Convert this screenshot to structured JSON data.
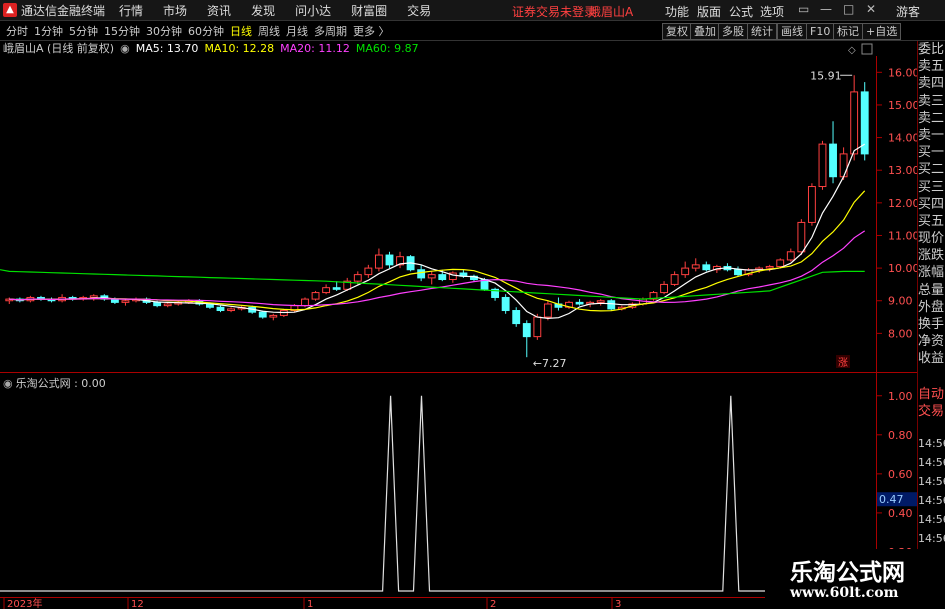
{
  "menubar": {
    "app_title": "通达信金融终端",
    "items": [
      "行情",
      "市场",
      "资讯",
      "发现",
      "问小达",
      "财富圈",
      "交易"
    ],
    "warning": "证券交易未登录",
    "stock": "峨眉山A",
    "right_items": [
      "功能",
      "版面",
      "公式",
      "选项"
    ],
    "guest": "游客"
  },
  "periods": [
    "分时",
    "1分钟",
    "5分钟",
    "15分钟",
    "30分钟",
    "60分钟",
    "日线",
    "周线",
    "月线",
    "多周期",
    "更多 〉"
  ],
  "active_period": "日线",
  "toolbar": [
    "复权",
    "叠加",
    "多股",
    "统计",
    "画线",
    "F10",
    "标记",
    "+自选"
  ],
  "legend": {
    "title": "峨眉山A (日线 前复权)",
    "ma5": "MA5: 13.70",
    "ma10": "MA10: 12.28",
    "ma20": "MA20: 11.12",
    "ma60": "MA60: 9.87",
    "colors": {
      "ma5": "#ffffff",
      "ma10": "#ffff00",
      "ma20": "#ff40ff",
      "ma60": "#00e000"
    }
  },
  "main_axis": [
    "16.00",
    "15.00",
    "14.00",
    "13.00",
    "12.00",
    "11.00",
    "10.00",
    "9.00",
    "8.00"
  ],
  "annotations": {
    "high": "15.91",
    "low": "7.27",
    "zhang": "涨"
  },
  "indicator": {
    "name": "乐淘公式网 : 0.00",
    "axis": [
      "1.00",
      "0.80",
      "0.60",
      "0.47",
      "0.40",
      "0.20"
    ],
    "highlight": "0.47"
  },
  "x_axis": [
    "2023年",
    "12",
    "1",
    "2",
    "3"
  ],
  "right_panel": {
    "items": [
      "委比",
      "卖五",
      "卖四",
      "卖三",
      "卖二",
      "卖一",
      "买一",
      "买二",
      "买三",
      "买四",
      "买五",
      "现价",
      "涨跌",
      "涨幅",
      "总量",
      "外盘",
      "换手",
      "净资",
      "收益"
    ],
    "lower": [
      "自动",
      "交易"
    ],
    "times": [
      "14:56",
      "14:56",
      "14:56",
      "14:56",
      "14:56",
      "14:56",
      "14:56"
    ]
  },
  "watermark": {
    "name": "乐淘公式网",
    "url": "www.60lt.com"
  },
  "chart_data": {
    "type": "candlestick",
    "price_ylim": [
      7.0,
      16.5
    ],
    "candles": [
      [
        9.0,
        9.1,
        8.9,
        9.05
      ],
      [
        9.05,
        9.1,
        8.95,
        9.0
      ],
      [
        9.0,
        9.15,
        8.95,
        9.1
      ],
      [
        9.1,
        9.15,
        9.0,
        9.05
      ],
      [
        9.05,
        9.1,
        8.95,
        9.0
      ],
      [
        9.0,
        9.2,
        8.95,
        9.1
      ],
      [
        9.1,
        9.15,
        9.0,
        9.05
      ],
      [
        9.05,
        9.15,
        9.0,
        9.1
      ],
      [
        9.1,
        9.2,
        9.0,
        9.15
      ],
      [
        9.15,
        9.2,
        9.0,
        9.05
      ],
      [
        9.05,
        9.1,
        8.9,
        8.95
      ],
      [
        8.95,
        9.05,
        8.85,
        9.0
      ],
      [
        9.0,
        9.1,
        8.95,
        9.05
      ],
      [
        9.05,
        9.1,
        8.9,
        8.95
      ],
      [
        8.95,
        9.0,
        8.8,
        8.85
      ],
      [
        8.85,
        8.95,
        8.8,
        8.9
      ],
      [
        8.9,
        9.0,
        8.85,
        8.95
      ],
      [
        8.95,
        9.05,
        8.9,
        9.0
      ],
      [
        9.0,
        9.05,
        8.85,
        8.9
      ],
      [
        8.9,
        8.95,
        8.75,
        8.8
      ],
      [
        8.8,
        8.85,
        8.65,
        8.7
      ],
      [
        8.7,
        8.8,
        8.65,
        8.75
      ],
      [
        8.75,
        8.85,
        8.7,
        8.8
      ],
      [
        8.8,
        8.85,
        8.6,
        8.65
      ],
      [
        8.65,
        8.7,
        8.45,
        8.5
      ],
      [
        8.5,
        8.6,
        8.4,
        8.55
      ],
      [
        8.55,
        8.75,
        8.5,
        8.7
      ],
      [
        8.7,
        8.9,
        8.65,
        8.85
      ],
      [
        8.85,
        9.1,
        8.8,
        9.05
      ],
      [
        9.05,
        9.3,
        9.0,
        9.25
      ],
      [
        9.25,
        9.5,
        9.2,
        9.4
      ],
      [
        9.4,
        9.6,
        9.3,
        9.35
      ],
      [
        9.35,
        9.7,
        9.3,
        9.6
      ],
      [
        9.6,
        9.9,
        9.5,
        9.8
      ],
      [
        9.8,
        10.1,
        9.7,
        10.0
      ],
      [
        10.0,
        10.6,
        9.9,
        10.4
      ],
      [
        10.4,
        10.5,
        10.0,
        10.1
      ],
      [
        10.1,
        10.5,
        10.0,
        10.35
      ],
      [
        10.35,
        10.4,
        9.9,
        9.95
      ],
      [
        9.95,
        10.1,
        9.6,
        9.7
      ],
      [
        9.7,
        9.9,
        9.5,
        9.8
      ],
      [
        9.8,
        9.95,
        9.6,
        9.65
      ],
      [
        9.65,
        9.9,
        9.55,
        9.85
      ],
      [
        9.85,
        9.95,
        9.7,
        9.75
      ],
      [
        9.75,
        9.8,
        9.6,
        9.65
      ],
      [
        9.65,
        9.7,
        9.3,
        9.35
      ],
      [
        9.35,
        9.4,
        9.0,
        9.1
      ],
      [
        9.1,
        9.2,
        8.6,
        8.7
      ],
      [
        8.7,
        8.8,
        8.2,
        8.3
      ],
      [
        8.3,
        8.4,
        7.27,
        7.9
      ],
      [
        7.9,
        8.6,
        7.8,
        8.5
      ],
      [
        8.5,
        9.0,
        8.4,
        8.9
      ],
      [
        8.9,
        9.1,
        8.7,
        8.8
      ],
      [
        8.8,
        9.0,
        8.75,
        8.95
      ],
      [
        8.95,
        9.05,
        8.85,
        8.9
      ],
      [
        8.9,
        9.0,
        8.8,
        8.95
      ],
      [
        8.95,
        9.05,
        8.85,
        9.0
      ],
      [
        9.0,
        9.05,
        8.7,
        8.75
      ],
      [
        8.75,
        8.85,
        8.7,
        8.8
      ],
      [
        8.8,
        8.95,
        8.75,
        8.9
      ],
      [
        8.9,
        9.1,
        8.85,
        9.05
      ],
      [
        9.05,
        9.3,
        9.0,
        9.25
      ],
      [
        9.25,
        9.6,
        9.2,
        9.5
      ],
      [
        9.5,
        9.9,
        9.45,
        9.8
      ],
      [
        9.8,
        10.2,
        9.7,
        10.0
      ],
      [
        10.0,
        10.3,
        9.9,
        10.1
      ],
      [
        10.1,
        10.2,
        9.9,
        9.95
      ],
      [
        9.95,
        10.1,
        9.85,
        10.05
      ],
      [
        10.05,
        10.15,
        9.9,
        9.95
      ],
      [
        9.95,
        10.05,
        9.75,
        9.8
      ],
      [
        9.8,
        10.0,
        9.75,
        9.95
      ],
      [
        9.95,
        10.05,
        9.85,
        10.0
      ],
      [
        10.0,
        10.1,
        9.9,
        10.05
      ],
      [
        10.05,
        10.3,
        10.0,
        10.25
      ],
      [
        10.25,
        10.6,
        10.2,
        10.5
      ],
      [
        10.5,
        11.5,
        10.4,
        11.4
      ],
      [
        11.4,
        12.6,
        11.3,
        12.5
      ],
      [
        12.5,
        13.9,
        12.4,
        13.8
      ],
      [
        13.8,
        14.5,
        12.6,
        12.8
      ],
      [
        12.8,
        13.7,
        12.7,
        13.5
      ],
      [
        13.5,
        15.91,
        13.3,
        15.4
      ],
      [
        15.4,
        15.7,
        13.3,
        13.5
      ]
    ],
    "ma": {
      "MA5": [
        [
          0,
          9.05
        ],
        [
          40,
          9.7
        ],
        [
          50,
          8.1
        ],
        [
          70,
          9.9
        ],
        [
          77,
          13.7
        ],
        [
          79,
          14.1
        ]
      ],
      "MA10": [
        [
          0,
          9.0
        ],
        [
          42,
          9.65
        ],
        [
          55,
          8.6
        ],
        [
          70,
          9.85
        ],
        [
          77,
          12.28
        ],
        [
          79,
          12.6
        ]
      ],
      "MA20": [
        [
          0,
          9.0
        ],
        [
          45,
          9.6
        ],
        [
          58,
          8.8
        ],
        [
          72,
          9.8
        ],
        [
          77,
          11.12
        ],
        [
          79,
          11.4
        ]
      ],
      "MA60": [
        [
          0,
          9.9
        ],
        [
          30,
          9.6
        ],
        [
          60,
          9.05
        ],
        [
          72,
          9.3
        ],
        [
          77,
          9.87
        ],
        [
          79,
          9.9
        ]
      ]
    },
    "indicator_spikes_at": [
      25,
      27,
      47
    ],
    "indicator_ylim": [
      0,
      1.05
    ]
  }
}
